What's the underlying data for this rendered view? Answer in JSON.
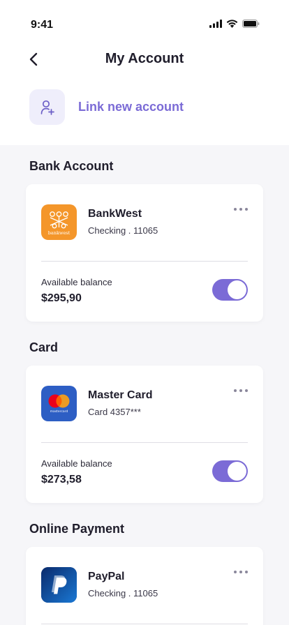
{
  "status_bar": {
    "time": "9:41"
  },
  "header": {
    "title": "My Account"
  },
  "link_account": {
    "label": "Link new account"
  },
  "sections": [
    {
      "title": "Bank Account",
      "card": {
        "name": "BankWest",
        "subtitle": "Checking . 11065",
        "logo_icon": "bankwest-logo",
        "logo_text": "bankwest",
        "balance_label": "Available balance",
        "balance": "$295,90",
        "toggle_on": true
      }
    },
    {
      "title": "Card",
      "card": {
        "name": "Master Card",
        "subtitle": "Card 4357***",
        "logo_icon": "mastercard-logo",
        "logo_text": "mastercard",
        "balance_label": "Available balance",
        "balance": "$273,58",
        "toggle_on": true
      }
    },
    {
      "title": "Online Payment",
      "card": {
        "name": "PayPal",
        "subtitle": "Checking . 11065",
        "logo_icon": "paypal-logo"
      }
    }
  ],
  "colors": {
    "accent": "#7b6bd6",
    "background": "#f6f6f9",
    "bankwest_orange": "#f4962a",
    "mastercard_blue": "#2d5ec4",
    "paypal_blue": "#0f3a8a"
  }
}
